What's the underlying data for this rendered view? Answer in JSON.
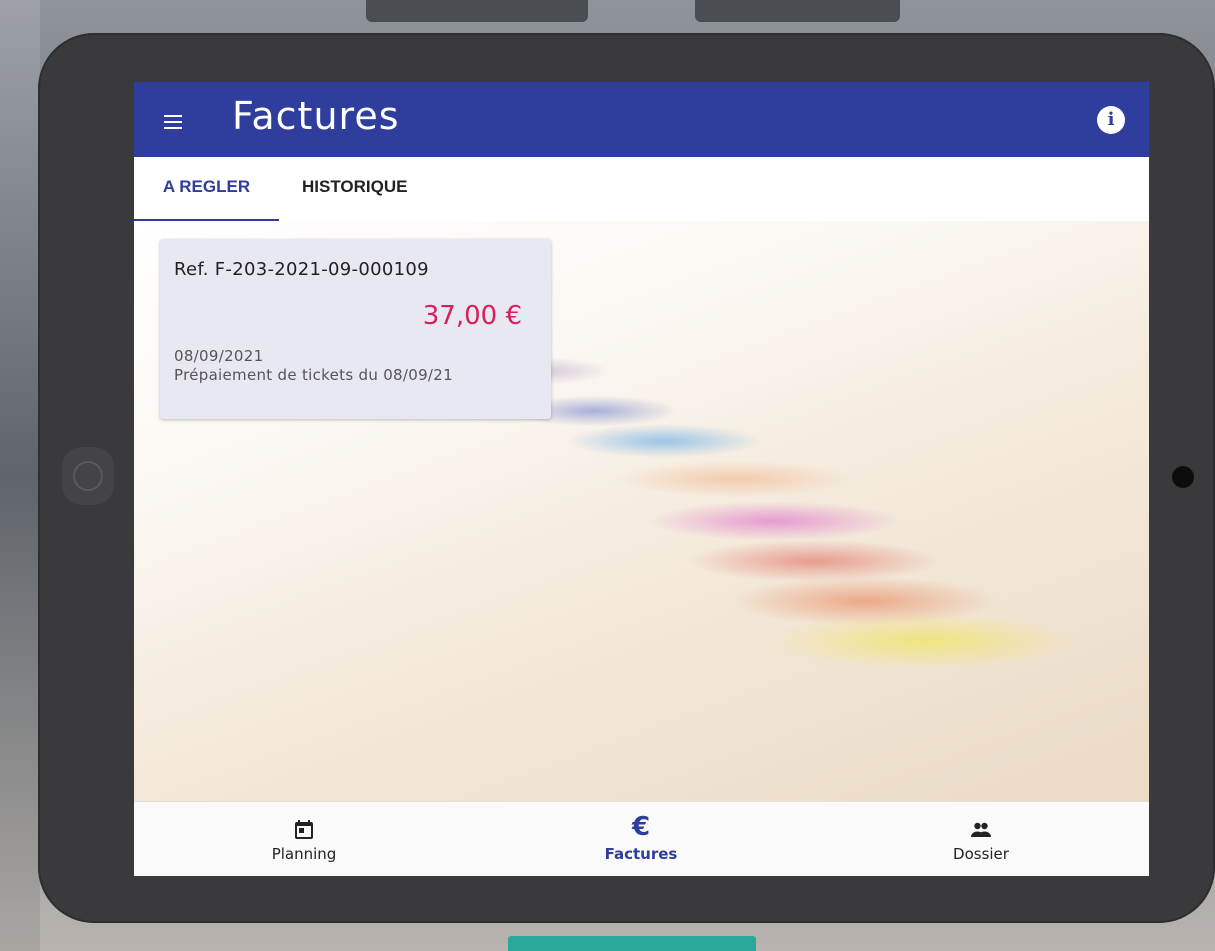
{
  "app": {
    "title": "Factures"
  },
  "header": {
    "menu_icon": "menu-icon",
    "info_icon": "info-icon",
    "info_glyph": "i"
  },
  "tabs": [
    {
      "label": "A REGLER",
      "active": true
    },
    {
      "label": "HISTORIQUE",
      "active": false
    }
  ],
  "invoices": [
    {
      "ref": "Ref. F-203-2021-09-000109",
      "amount": "37,00 €",
      "date": "08/09/2021",
      "description": "Prépaiement de tickets du 08/09/21"
    }
  ],
  "bottom_nav": [
    {
      "label": "Planning",
      "icon": "calendar-icon",
      "active": false
    },
    {
      "label": "Factures",
      "icon": "euro-icon",
      "glyph": "€",
      "active": true
    },
    {
      "label": "Dossier",
      "icon": "people-icon",
      "active": false
    }
  ],
  "colors": {
    "primary": "#2f3d9c",
    "amount": "#d81e5b",
    "card_bg": "#e8e8f3"
  }
}
